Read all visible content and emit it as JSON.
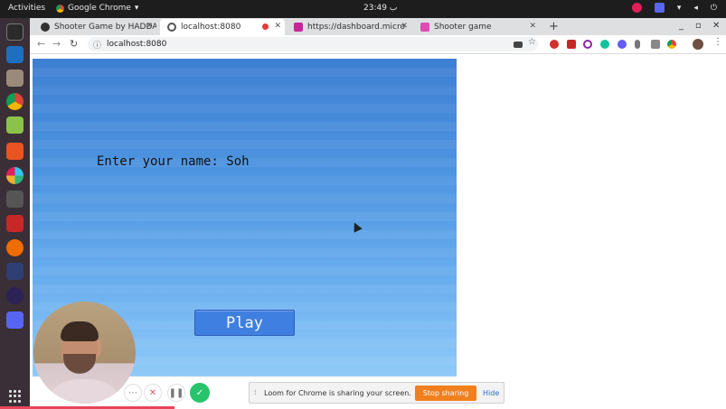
{
  "topbar": {
    "activities": "Activities",
    "app_name": "Google Chrome",
    "clock": "23:49 ب"
  },
  "tabs": [
    {
      "label": "Shooter Game by HADDA",
      "active": false
    },
    {
      "label": "localhost:8080",
      "active": true
    },
    {
      "label": "https://dashboard.micro",
      "active": false
    },
    {
      "label": "Shooter game",
      "active": false
    }
  ],
  "address": {
    "url": "localhost:8080"
  },
  "game": {
    "prompt": "Enter your name: Soh",
    "play_label": "Play"
  },
  "loom": {
    "share_message": "Loom for Chrome is sharing your screen.",
    "stop_label": "Stop sharing",
    "hide_label": "Hide"
  },
  "colors": {
    "stop_button": "#f07f1d",
    "done_button": "#27c46b",
    "game_sky_top": "#3e7fd3",
    "game_sky_bottom": "#8fcaf8",
    "play_button": "#3f7fdf"
  }
}
